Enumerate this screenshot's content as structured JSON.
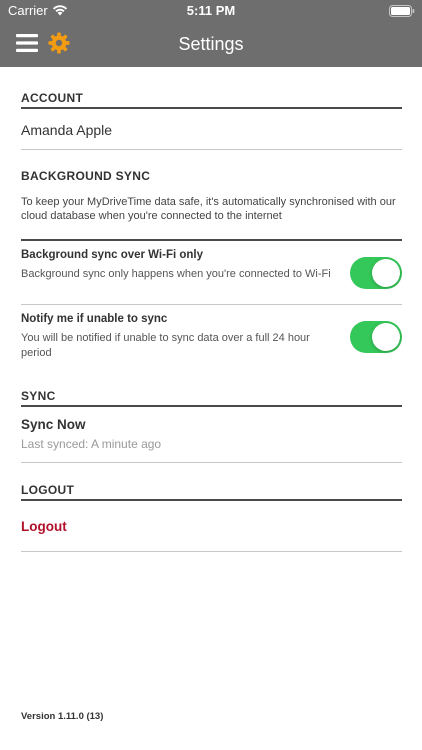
{
  "status_bar": {
    "carrier": "Carrier",
    "time": "5:11 PM"
  },
  "nav": {
    "title": "Settings",
    "menu_icon": "hamburger-menu-icon",
    "settings_icon": "gear-icon",
    "gear_color": "#f39c12",
    "bar_color": "#6e6e6e"
  },
  "account": {
    "header": "ACCOUNT",
    "name": "Amanda Apple"
  },
  "background_sync": {
    "header": "BACKGROUND SYNC",
    "description": "To keep your MyDriveTime data safe, it's automatically synchronised with our cloud database when you're connected to the internet",
    "options": [
      {
        "title": "Background sync over Wi-Fi only",
        "description": "Background sync only happens when you're connected to Wi-Fi",
        "enabled": true
      },
      {
        "title": "Notify me if unable to sync",
        "description": "You will be notified if unable to sync data over a full 24 hour period",
        "enabled": true
      }
    ],
    "toggle_color": "#34c759"
  },
  "sync": {
    "header": "SYNC",
    "action": "Sync Now",
    "last_synced": "Last synced: A minute ago"
  },
  "logout": {
    "header": "LOGOUT",
    "action": "Logout",
    "color": "#b0102a"
  },
  "footer": {
    "version": "Version 1.11.0 (13)"
  }
}
